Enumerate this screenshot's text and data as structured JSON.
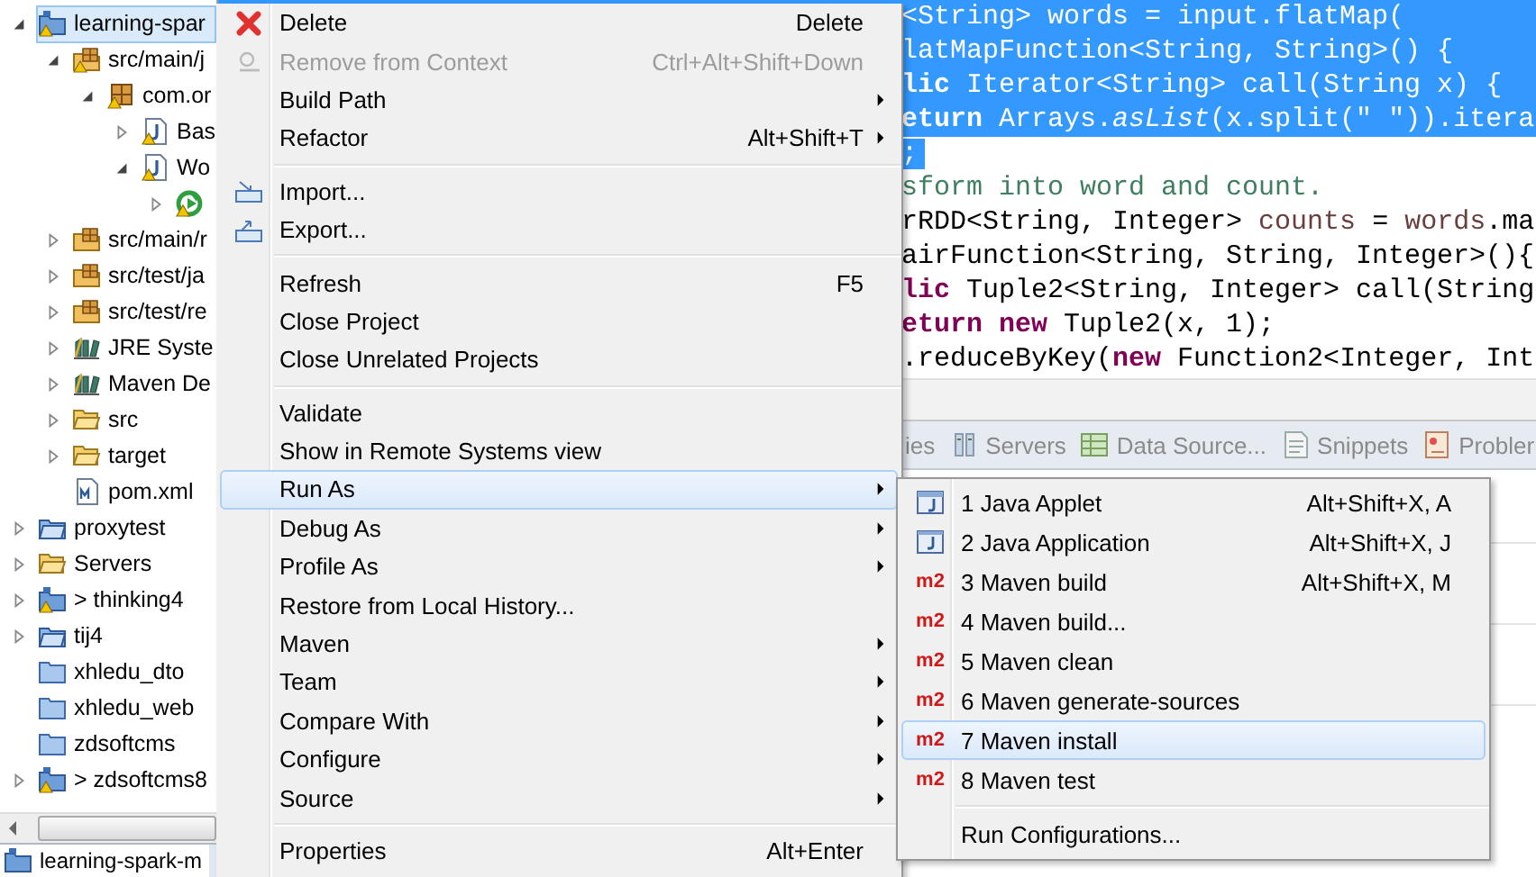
{
  "project_explorer": {
    "tree": [
      {
        "label": "learning-spar",
        "kind": "maven-project",
        "warning": true,
        "expanded": true,
        "selected": true,
        "children": [
          {
            "label": "src/main/j",
            "kind": "source-folder",
            "warning": true,
            "expanded": true,
            "selected": false,
            "children": [
              {
                "label": "com.or",
                "kind": "package",
                "warning": true,
                "expanded": true,
                "selected": false,
                "children": [
                  {
                    "label": "Bas",
                    "kind": "java-file",
                    "warning": true,
                    "expanded": false,
                    "selected": false
                  },
                  {
                    "label": "Wo",
                    "kind": "java-file",
                    "warning": true,
                    "expanded": true,
                    "selected": false,
                    "children": [
                      {
                        "kind": "run-class",
                        "warning": true,
                        "expanded": false,
                        "selected": false
                      }
                    ]
                  }
                ]
              }
            ]
          },
          {
            "label": "src/main/r",
            "kind": "source-folder",
            "warning": false,
            "expanded": false,
            "selected": false
          },
          {
            "label": "src/test/ja",
            "kind": "source-folder",
            "warning": false,
            "expanded": false,
            "selected": false
          },
          {
            "label": "src/test/re",
            "kind": "source-folder",
            "warning": false,
            "expanded": false,
            "selected": false
          },
          {
            "label": "JRE Syste",
            "kind": "library",
            "warning": false,
            "expanded": false,
            "selected": false
          },
          {
            "label": "Maven De",
            "kind": "library",
            "warning": false,
            "expanded": false,
            "selected": false
          },
          {
            "label": "src",
            "kind": "folder-open",
            "warning": false,
            "expanded": false,
            "selected": false
          },
          {
            "label": "target",
            "kind": "folder-open",
            "warning": false,
            "expanded": false,
            "selected": false
          },
          {
            "label": "pom.xml",
            "kind": "xml-file",
            "warning": false,
            "selected": false
          }
        ]
      },
      {
        "label": "proxytest",
        "kind": "project",
        "warning": false,
        "expanded": false,
        "selected": false
      },
      {
        "label": "Servers",
        "kind": "folder-open",
        "warning": false,
        "expanded": false,
        "selected": false
      },
      {
        "label": "> thinking4",
        "kind": "maven-project",
        "warning": true,
        "expanded": false,
        "selected": false
      },
      {
        "label": "tij4",
        "kind": "project",
        "warning": false,
        "expanded": false,
        "selected": false
      },
      {
        "label": "xhledu_dto",
        "kind": "closed-project",
        "warning": false,
        "selected": false
      },
      {
        "label": "xhledu_web",
        "kind": "closed-project",
        "warning": false,
        "selected": false
      },
      {
        "label": "zdsoftcms",
        "kind": "closed-project",
        "warning": false,
        "selected": false
      },
      {
        "label": "> zdsoftcms8",
        "kind": "maven-project",
        "warning": true,
        "expanded": false,
        "selected": false
      }
    ],
    "bottom_tab": {
      "label": "learning-spark-m",
      "kind": "maven-project"
    }
  },
  "editor": {
    "lines": [
      {
        "selected": true,
        "tokens": [
          {
            "kind": "plain",
            "text": "<String> words = input.flatMap("
          }
        ]
      },
      {
        "selected": true,
        "tokens": [
          {
            "kind": "plain",
            "text": "latMapFunction<String, String>() {"
          }
        ]
      },
      {
        "selected": true,
        "tokens": [
          {
            "kind": "keyword",
            "text": "lic"
          },
          {
            "kind": "plain",
            "text": " Iterator<String> call(String x) {"
          }
        ]
      },
      {
        "selected": true,
        "tokens": [
          {
            "kind": "keyword",
            "text": "eturn"
          },
          {
            "kind": "plain",
            "text": " Arrays."
          },
          {
            "kind": "static",
            "text": "asList"
          },
          {
            "kind": "plain",
            "text": "(x.split(\" \")).itera"
          }
        ]
      },
      {
        "selected": true,
        "tokens": [
          {
            "kind": "plain",
            "text": ";"
          }
        ]
      },
      {
        "selected": false,
        "tokens": [
          {
            "kind": "comment",
            "text": "sform into word and count."
          }
        ]
      },
      {
        "selected": false,
        "tokens": [
          {
            "kind": "plain",
            "text": "rRDD<String, Integer> "
          },
          {
            "kind": "local",
            "text": "counts"
          },
          {
            "kind": "plain",
            "text": " = "
          },
          {
            "kind": "local",
            "text": "words"
          },
          {
            "kind": "plain",
            "text": ".ma"
          }
        ]
      },
      {
        "selected": false,
        "tokens": [
          {
            "kind": "plain",
            "text": "airFunction<String, String, Integer>(){"
          }
        ]
      },
      {
        "selected": false,
        "tokens": [
          {
            "kind": "keyword",
            "text": "lic"
          },
          {
            "kind": "plain",
            "text": " Tuple2<String, Integer> call(String"
          }
        ]
      },
      {
        "selected": false,
        "tokens": [
          {
            "kind": "keyword",
            "text": "eturn new"
          },
          {
            "kind": "plain",
            "text": " Tuple2(x, 1);"
          }
        ]
      },
      {
        "selected": false,
        "tokens": [
          {
            "kind": "plain",
            "text": ".reduceByKey("
          },
          {
            "kind": "keyword",
            "text": "new"
          },
          {
            "kind": "plain",
            "text": " Function2<Integer, Int"
          }
        ]
      }
    ]
  },
  "views": {
    "tabs": [
      {
        "label": "ies",
        "kind": "plain",
        "selected": false
      },
      {
        "label": "Servers",
        "kind": "servers",
        "selected": false
      },
      {
        "label": "Data Source...",
        "kind": "data-source",
        "selected": false
      },
      {
        "label": "Snippets",
        "kind": "snippets",
        "selected": false
      },
      {
        "label": "Probler",
        "kind": "problems",
        "selected": false
      }
    ]
  },
  "context_menu": {
    "items": [
      {
        "kind": "delete",
        "label": "Delete",
        "shortcut": "Delete",
        "submenu": false,
        "disabled": false,
        "selected": false
      },
      {
        "kind": "remove",
        "label": "Remove from Context",
        "shortcut": "Ctrl+Alt+Shift+Down",
        "submenu": false,
        "disabled": true,
        "selected": false
      },
      {
        "kind": "plain",
        "label": "Build Path",
        "submenu": true,
        "disabled": false,
        "selected": false
      },
      {
        "kind": "plain",
        "label": "Refactor",
        "shortcut": "Alt+Shift+T",
        "submenu": true,
        "disabled": false,
        "selected": false
      },
      {
        "kind": "separator"
      },
      {
        "kind": "import",
        "label": "Import...",
        "submenu": false,
        "disabled": false,
        "selected": false
      },
      {
        "kind": "export",
        "label": "Export...",
        "submenu": false,
        "disabled": false,
        "selected": false
      },
      {
        "kind": "separator"
      },
      {
        "kind": "plain",
        "label": "Refresh",
        "shortcut": "F5",
        "submenu": false,
        "disabled": false,
        "selected": false
      },
      {
        "kind": "plain",
        "label": "Close Project",
        "submenu": false,
        "disabled": false,
        "selected": false
      },
      {
        "kind": "plain",
        "label": "Close Unrelated Projects",
        "submenu": false,
        "disabled": false,
        "selected": false
      },
      {
        "kind": "separator"
      },
      {
        "kind": "plain",
        "label": "Validate",
        "submenu": false,
        "disabled": false,
        "selected": false
      },
      {
        "kind": "plain",
        "label": "Show in Remote Systems view",
        "submenu": false,
        "disabled": false,
        "selected": false
      },
      {
        "kind": "plain",
        "label": "Run As",
        "submenu": true,
        "disabled": false,
        "selected": true
      },
      {
        "kind": "plain",
        "label": "Debug As",
        "submenu": true,
        "disabled": false,
        "selected": false
      },
      {
        "kind": "plain",
        "label": "Profile As",
        "submenu": true,
        "disabled": false,
        "selected": false
      },
      {
        "kind": "plain",
        "label": "Restore from Local History...",
        "submenu": false,
        "disabled": false,
        "selected": false
      },
      {
        "kind": "plain",
        "label": "Maven",
        "submenu": true,
        "disabled": false,
        "selected": false
      },
      {
        "kind": "plain",
        "label": "Team",
        "submenu": true,
        "disabled": false,
        "selected": false
      },
      {
        "kind": "plain",
        "label": "Compare With",
        "submenu": true,
        "disabled": false,
        "selected": false
      },
      {
        "kind": "plain",
        "label": "Configure",
        "submenu": true,
        "disabled": false,
        "selected": false
      },
      {
        "kind": "plain",
        "label": "Source",
        "submenu": true,
        "disabled": false,
        "selected": false
      },
      {
        "kind": "separator"
      },
      {
        "kind": "plain",
        "label": "Properties",
        "shortcut": "Alt+Enter",
        "submenu": false,
        "disabled": false,
        "selected": false
      }
    ]
  },
  "run_as_submenu": {
    "items": [
      {
        "kind": "applet",
        "label": "1 Java Applet",
        "shortcut": "Alt+Shift+X, A",
        "selected": false
      },
      {
        "kind": "java-application",
        "label": "2 Java Application",
        "shortcut": "Alt+Shift+X, J",
        "selected": false
      },
      {
        "kind": "maven",
        "badge": "m2",
        "label": "3 Maven build",
        "shortcut": "Alt+Shift+X, M",
        "selected": false
      },
      {
        "kind": "maven",
        "badge": "m2",
        "label": "4 Maven build...",
        "selected": false
      },
      {
        "kind": "maven",
        "badge": "m2",
        "label": "5 Maven clean",
        "selected": false
      },
      {
        "kind": "maven",
        "badge": "m2",
        "label": "6 Maven generate-sources",
        "selected": false
      },
      {
        "kind": "maven",
        "badge": "m2",
        "label": "7 Maven install",
        "selected": true
      },
      {
        "kind": "maven",
        "badge": "m2",
        "label": "8 Maven test",
        "selected": false
      },
      {
        "kind": "separator"
      },
      {
        "kind": "plain",
        "label": "Run Configurations...",
        "selected": false
      }
    ]
  }
}
